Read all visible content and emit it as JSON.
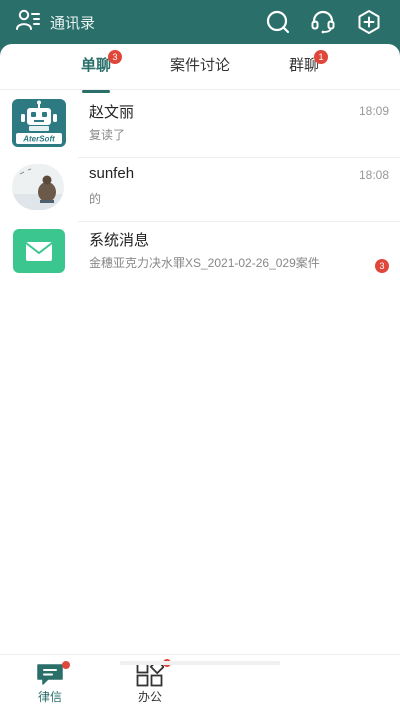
{
  "header": {
    "contacts_label": "通讯录",
    "icons": [
      "contacts-icon",
      "search-icon",
      "headset-icon",
      "add-icon"
    ]
  },
  "tabs": [
    {
      "label": "单聊",
      "badge": "3",
      "active": true
    },
    {
      "label": "案件讨论",
      "badge": "",
      "active": false
    },
    {
      "label": "群聊",
      "badge": "1",
      "active": false
    }
  ],
  "conversations": [
    {
      "name": "赵文丽",
      "time": "18:09",
      "preview": "复读了",
      "avatar": "robot-avatar",
      "avatar_text": "AterSoft",
      "badge": ""
    },
    {
      "name": "sunfeh",
      "time": "18:08",
      "preview": "的",
      "avatar": "photo-avatar",
      "badge": ""
    },
    {
      "name": "系统消息",
      "time": "",
      "preview": "金穗亚克力决水罪XS_2021-02-26_029案件",
      "avatar": "envelope-avatar",
      "badge": "3"
    }
  ],
  "bottom_nav": [
    {
      "label": "律信",
      "icon": "chat-icon",
      "active": true,
      "dot": true
    },
    {
      "label": "办公",
      "icon": "apps-icon",
      "active": false,
      "dot": true
    }
  ],
  "colors": {
    "brand": "#2a6f6a",
    "badge": "#e0473a",
    "envelope": "#3cc68f",
    "robot_bg": "#2d7a82"
  }
}
